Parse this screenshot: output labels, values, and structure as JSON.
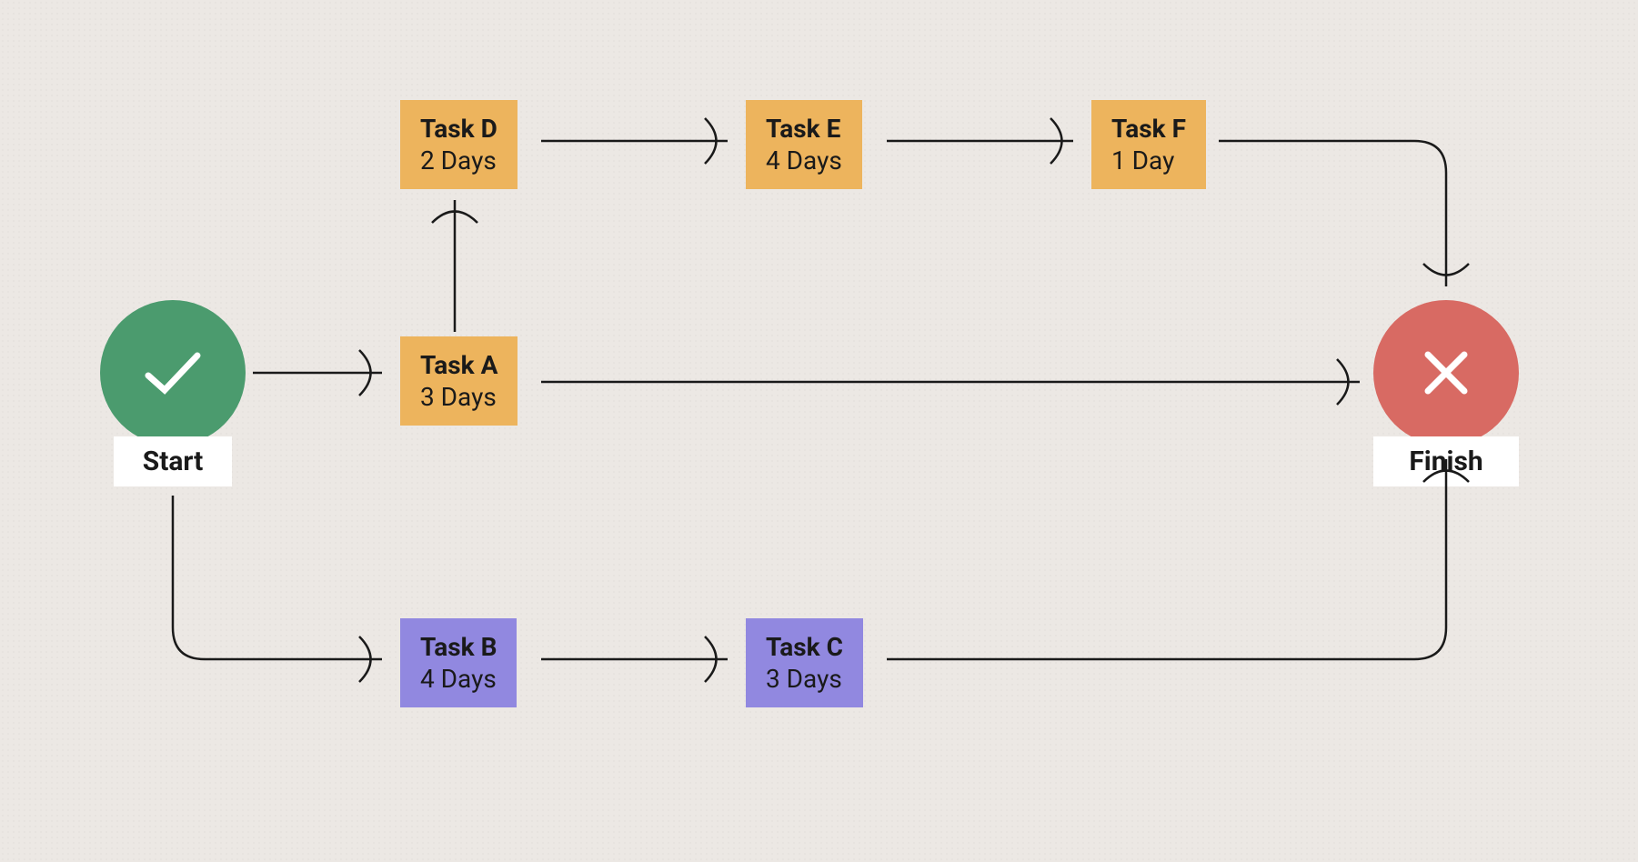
{
  "start": {
    "label": "Start"
  },
  "finish": {
    "label": "Finish"
  },
  "tasks": {
    "a": {
      "title": "Task A",
      "days": "3 Days"
    },
    "b": {
      "title": "Task B",
      "days": "4 Days"
    },
    "c": {
      "title": "Task C",
      "days": "3 Days"
    },
    "d": {
      "title": "Task D",
      "days": "2 Days"
    },
    "e": {
      "title": "Task E",
      "days": "4 Days"
    },
    "f": {
      "title": "Task F",
      "days": "1 Day"
    }
  },
  "colors": {
    "start": "#4b9b6e",
    "finish": "#d86a63",
    "pathTop": "#edb45d",
    "pathBottom": "#9188e0"
  }
}
